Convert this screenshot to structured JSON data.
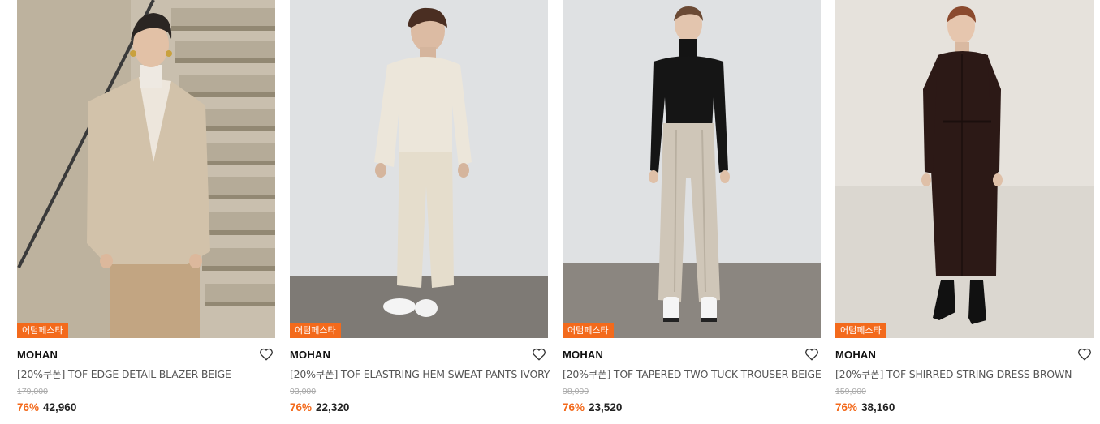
{
  "products": [
    {
      "badge": "어텀페스타",
      "brand": "MOHAN",
      "name": "[20%쿠폰] TOF EDGE DETAIL BLAZER BEIGE",
      "original_price": "179,000",
      "discount": "76%",
      "sale_price": "42,960",
      "icon": "heart-outline-icon"
    },
    {
      "badge": "어텀페스타",
      "brand": "MOHAN",
      "name": "[20%쿠폰] TOF ELASTRING HEM SWEAT PANTS IVORY",
      "original_price": "93,000",
      "discount": "76%",
      "sale_price": "22,320",
      "icon": "heart-outline-icon"
    },
    {
      "badge": "어텀페스타",
      "brand": "MOHAN",
      "name": "[20%쿠폰] TOF TAPERED TWO TUCK TROUSER BEIGE",
      "original_price": "98,000",
      "discount": "76%",
      "sale_price": "23,520",
      "icon": "heart-outline-icon"
    },
    {
      "badge": "어텀페스타",
      "brand": "MOHAN",
      "name": "[20%쿠폰] TOF SHIRRED STRING DRESS BROWN",
      "original_price": "159,000",
      "discount": "76%",
      "sale_price": "38,160",
      "icon": "heart-outline-icon"
    }
  ],
  "colors": {
    "accent": "#f36a1c",
    "strike": "#aaaaaa"
  }
}
